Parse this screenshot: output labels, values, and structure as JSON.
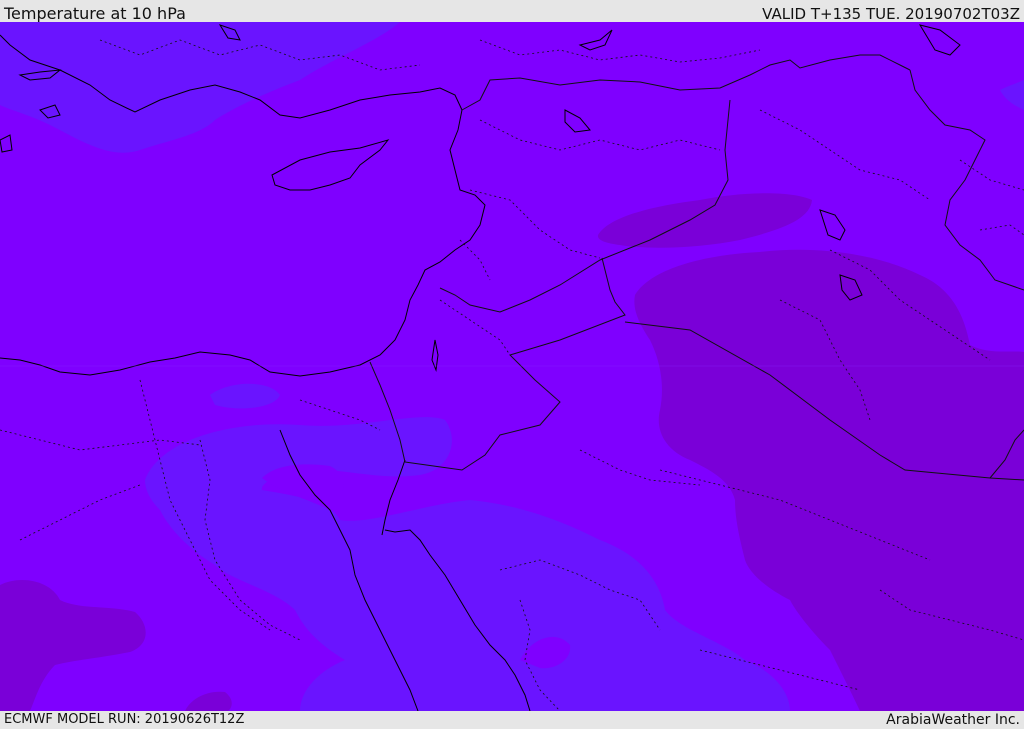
{
  "header": {
    "title": "Temperature at 10 hPa",
    "valid": "VALID T+135 TUE. 20190702T03Z"
  },
  "footer": {
    "model_run": "ECMWF MODEL RUN: 20190626T12Z",
    "credit": "ArabiaWeather Inc."
  },
  "colors": {
    "base": "#7f00ff",
    "cool": "#6a14ff",
    "warm": "#8000e6",
    "warmer": "#7a00dc",
    "coast": "#000000",
    "border": "#111111",
    "background": "#e6e6e6"
  }
}
